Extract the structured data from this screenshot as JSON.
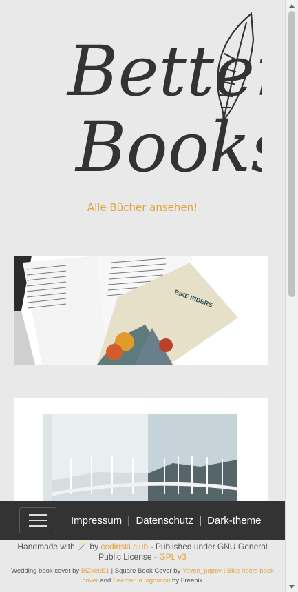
{
  "logo": {
    "line1": "Better",
    "line2": "Books"
  },
  "all_books_link": "Alle Bücher ansehen!",
  "navbar": {
    "menu_toggle_icon": "hamburger-icon",
    "impressum": "Impressum",
    "sep1": "|",
    "datenschutz": "Datenschutz",
    "sep2": "|",
    "dark_theme": "Dark-theme"
  },
  "footer": {
    "handmade": "Handmade with",
    "wand_icon": "magic-wand-icon",
    "by": "by",
    "codinski": "codinski.club",
    "published": "- Published under GNU General Public License -",
    "gpl": "GPL v3",
    "credit_wedding": "Wedding book cover by",
    "bizkette": "BiZkettE1",
    "credit_square": "| Square Book Cover by",
    "yeven": "Yeven_popov",
    "bike_sep": "|",
    "bike_link": "Bike riders book cover",
    "and": "and",
    "feather_link": "Feather in logo/icon",
    "by_freepik": "by Freepik"
  },
  "colors": {
    "accent": "#e2a33c",
    "navbar": "#333333",
    "background": "#e9e9e9"
  }
}
